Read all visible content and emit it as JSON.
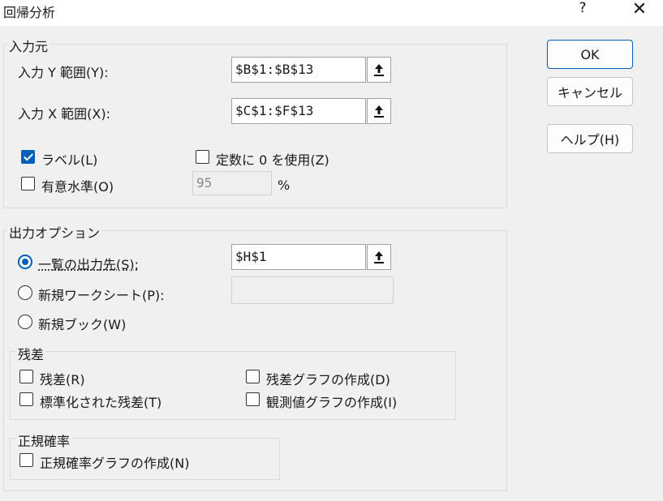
{
  "window": {
    "title": "回帰分析",
    "help": "?",
    "close": "✕"
  },
  "input": {
    "group_label": "入力元",
    "y_label": "入力 Y 範囲(Y):",
    "y_value": "$B$1:$B$13",
    "x_label": "入力 X 範囲(X):",
    "x_value": "$C$1:$F$13",
    "labels_label": "ラベル(L)",
    "labels_checked": true,
    "const_zero_label": "定数に 0 を使用(Z)",
    "const_zero_checked": false,
    "confidence_label": "有意水準(O)",
    "confidence_checked": false,
    "confidence_value": "95",
    "percent": "%"
  },
  "output": {
    "group_label": "出力オプション",
    "range_label": "一覧の出力先(S):",
    "range_value": "$H$1",
    "new_sheet_label": "新規ワークシート(P):",
    "new_sheet_value": "",
    "new_book_label": "新規ブック(W)",
    "selected": "range"
  },
  "residuals": {
    "group_label": "残差",
    "residuals": "残差(R)",
    "standardized": "標準化された残差(T)",
    "residual_plots": "残差グラフの作成(D)",
    "line_fit": "観測値グラフの作成(I)"
  },
  "normal": {
    "group_label": "正規確率",
    "plot": "正規確率グラフの作成(N)"
  },
  "buttons": {
    "ok": "OK",
    "cancel": "キャンセル",
    "help": "ヘルプ(H)"
  },
  "colors": {
    "accent": "#005fb8",
    "background": "#f0f0f0"
  },
  "icons": {
    "ref": "collapse-dialog-icon"
  }
}
